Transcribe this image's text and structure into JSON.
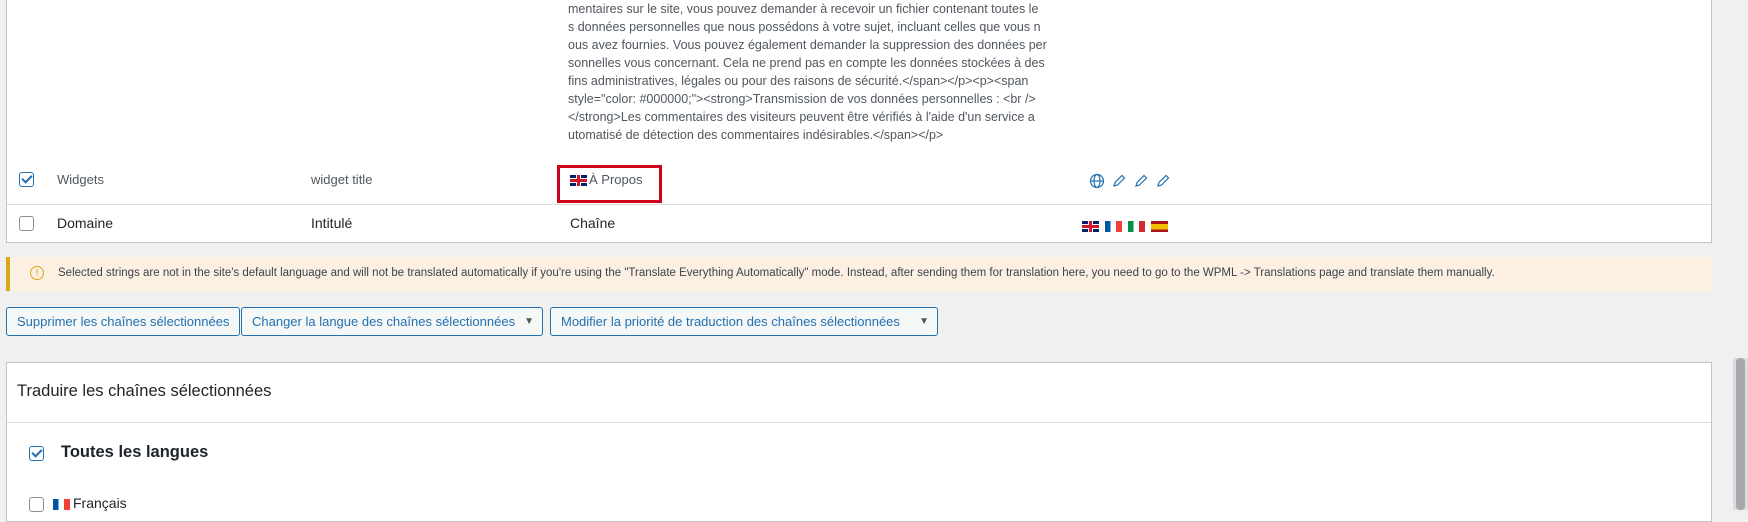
{
  "long_text_lines": [
    "mentaires sur le site, vous pouvez demander à recevoir un fichier contenant toutes le",
    "s données personnelles que nous possédons à votre sujet, incluant celles que vous n",
    "ous avez fournies. Vous pouvez également demander la suppression des données per",
    "sonnelles vous concernant. Cela ne prend pas en compte les données stockées à des",
    "fins administratives, légales ou pour des raisons de sécurité.</span></p><p><span",
    "style=\"color: #000000;\"><strong>Transmission de vos données personnelles : <br />",
    "</strong>Les commentaires des visiteurs peuvent être vérifiés à l'aide d'un service a",
    "utomatisé de détection des commentaires indésirables.</span></p>"
  ],
  "widgets_row": {
    "domain": "Widgets",
    "name": "widget title",
    "value": "À Propos",
    "flag": "uk-flag-icon",
    "action_icons": [
      "globe-icon",
      "pencil-icon",
      "pencil-icon",
      "pencil-icon"
    ]
  },
  "header_row": {
    "domain": "Domaine",
    "name": "Intitulé",
    "string": "Chaîne",
    "flags": [
      "uk-flag-icon",
      "fr-flag-icon",
      "it-flag-icon",
      "es-flag-icon"
    ]
  },
  "notice": {
    "text": "Selected strings are not in the site's default language and will not be translated automatically if you're using the \"Translate Everything Automatically\" mode. Instead, after sending them for translation here, you need to go to the WPML -> Translations page and translate them manually.",
    "icon": "warning-icon"
  },
  "buttons": {
    "delete": "Supprimer les chaînes sélectionnées",
    "change_language": "Changer la langue des chaînes sélectionnées",
    "change_priority": "Modifier la priorité de traduction des chaînes sélectionnées"
  },
  "panel": {
    "title": "Traduire les chaînes sélectionnées",
    "all_languages": "Toutes les langues",
    "francais": "Français"
  },
  "colors": {
    "accent": "#2271b1",
    "highlight": "#d0021b",
    "notice_bg": "#fcf0e3"
  }
}
